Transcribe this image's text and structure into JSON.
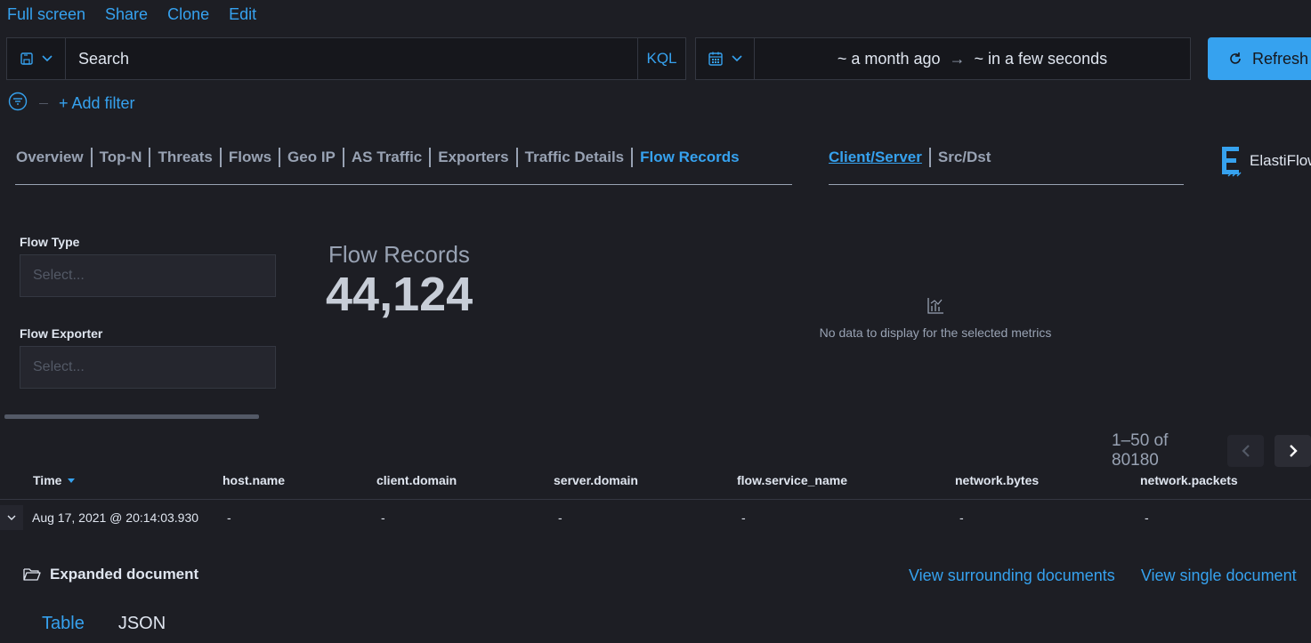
{
  "top_menu": {
    "full_screen": "Full screen",
    "share": "Share",
    "clone": "Clone",
    "edit": "Edit"
  },
  "query": {
    "search_placeholder": "Search",
    "language": "KQL"
  },
  "time": {
    "start": "~ a month ago",
    "arrow": "→",
    "end": "~ in a few seconds",
    "refresh_label": "Refresh"
  },
  "filters": {
    "add_filter": "+ Add filter"
  },
  "nav": {
    "tabs": [
      "Overview",
      "Top-N",
      "Threats",
      "Flows",
      "Geo IP",
      "AS Traffic",
      "Exporters",
      "Traffic Details",
      "Flow Records"
    ],
    "active": "Flow Records",
    "view_tabs": [
      "Client/Server",
      "Src/Dst"
    ],
    "view_active": "Client/Server",
    "logo_text": "ElastiFlow"
  },
  "controls": {
    "flow_type_label": "Flow Type",
    "flow_type_placeholder": "Select...",
    "flow_exporter_label": "Flow Exporter",
    "flow_exporter_placeholder": "Select..."
  },
  "metric": {
    "label": "Flow Records",
    "value": "44,124"
  },
  "chart_panel": {
    "empty_message": "No data to display for the selected metrics"
  },
  "pagination": {
    "text": "1–50 of 80180"
  },
  "table": {
    "columns": [
      "Time",
      "host.name",
      "client.domain",
      "server.domain",
      "flow.service_name",
      "network.bytes",
      "network.packets"
    ],
    "rows": [
      [
        "Aug 17, 2021 @ 20:14:03.930",
        "-",
        "-",
        "-",
        "-",
        "-",
        "-"
      ]
    ]
  },
  "document": {
    "expanded_label": "Expanded document",
    "view_surrounding": "View surrounding documents",
    "view_single": "View single document",
    "tab_table": "Table",
    "tab_json": "JSON"
  },
  "colors": {
    "background": "#1d1e24",
    "accent": "#36a2ef",
    "muted": "#98a2b3"
  }
}
